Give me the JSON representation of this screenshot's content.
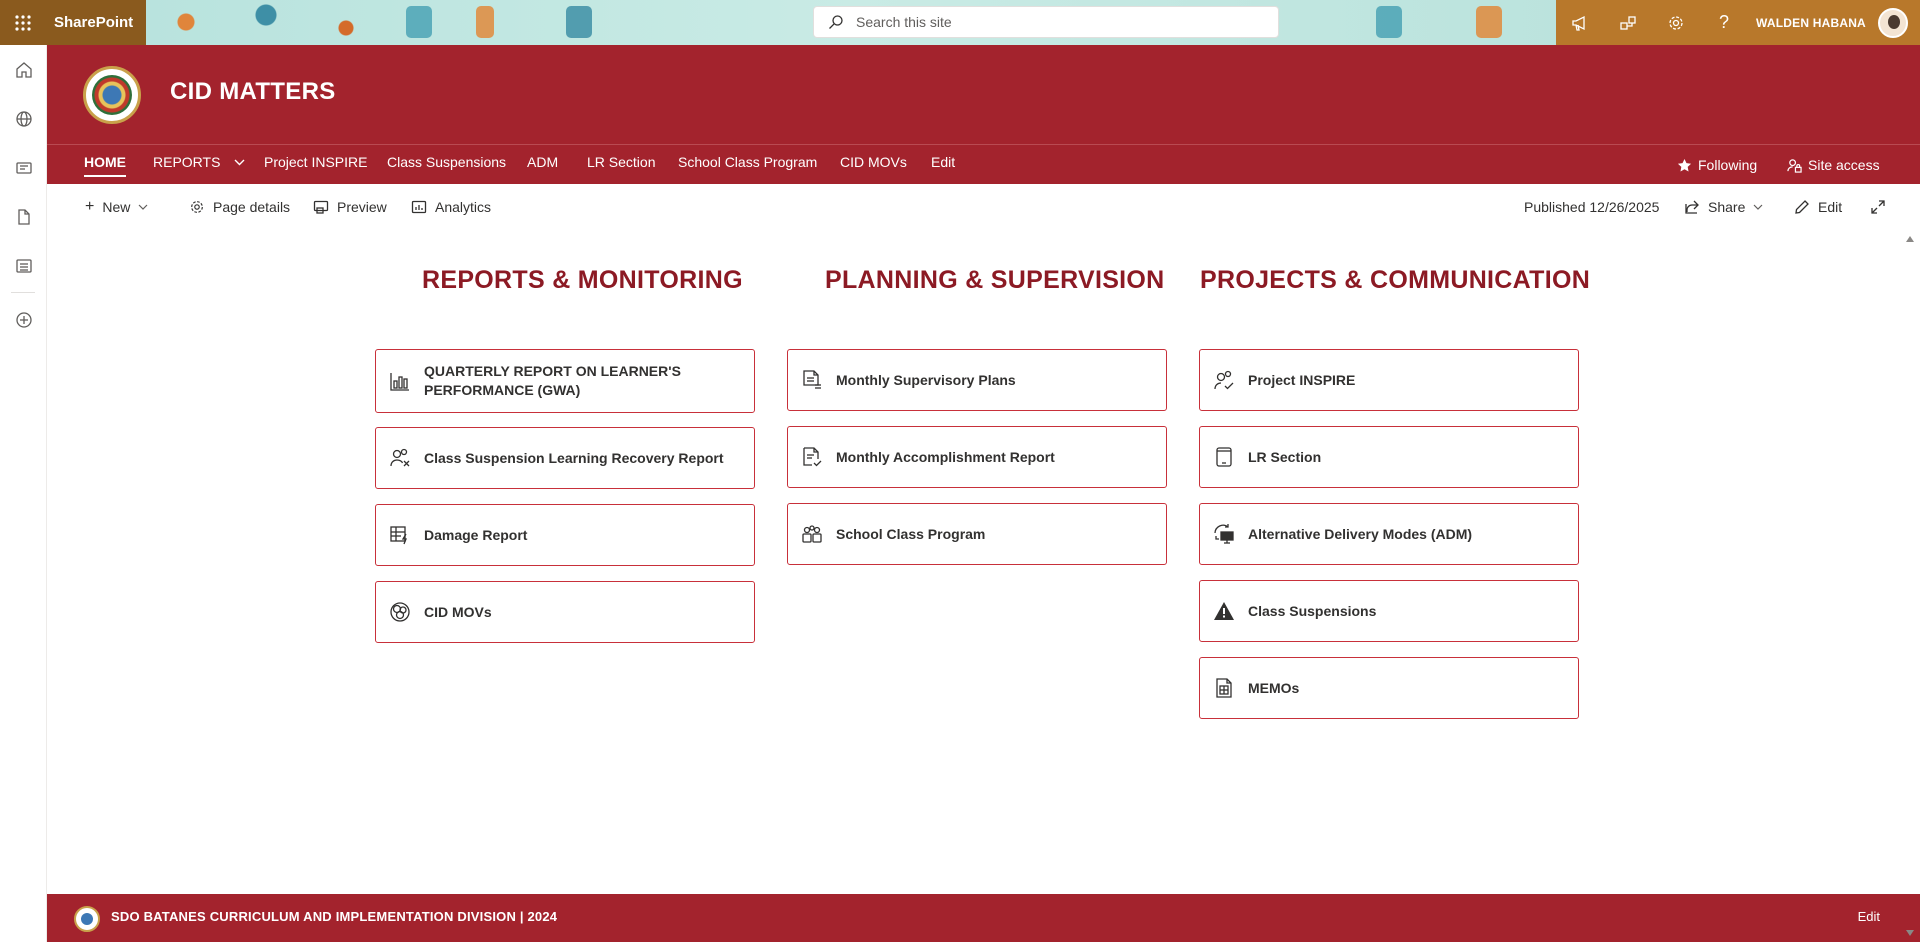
{
  "suite": {
    "brand": "SharePoint",
    "search_placeholder": "Search this site",
    "user_name": "WALDEN HABANA"
  },
  "site": {
    "title": "CID MATTERS"
  },
  "nav": {
    "items": [
      {
        "label": "HOME",
        "active": true
      },
      {
        "label": "REPORTS"
      },
      {
        "label": "Project INSPIRE"
      },
      {
        "label": "Class Suspensions"
      },
      {
        "label": "ADM"
      },
      {
        "label": "LR Section"
      },
      {
        "label": "School Class Program"
      },
      {
        "label": "CID MOVs"
      },
      {
        "label": "Edit"
      }
    ],
    "following": "Following",
    "site_access": "Site access"
  },
  "command": {
    "new": "New",
    "page_details": "Page details",
    "preview": "Preview",
    "analytics": "Analytics",
    "published": "Published 12/26/2025",
    "share": "Share",
    "edit": "Edit"
  },
  "sections": [
    {
      "title": "REPORTS & MONITORING",
      "links": [
        {
          "label": "QUARTERLY REPORT ON LEARNER'S PERFORMANCE (GWA)",
          "icon": "bar-chart-icon"
        },
        {
          "label": "Class Suspension Learning Recovery Report",
          "icon": "people-remove-icon"
        },
        {
          "label": "Damage Report",
          "icon": "table-lightning-icon"
        },
        {
          "label": "CID MOVs",
          "icon": "cluster-icon"
        }
      ]
    },
    {
      "title": "PLANNING & SUPERVISION",
      "links": [
        {
          "label": "Monthly Supervisory Plans",
          "icon": "document-list-icon"
        },
        {
          "label": "Monthly Accomplishment Report",
          "icon": "document-check-icon"
        },
        {
          "label": "School Class Program",
          "icon": "people-group-icon"
        }
      ]
    },
    {
      "title": "PROJECTS & COMMUNICATION",
      "links": [
        {
          "label": "Project INSPIRE",
          "icon": "people-check-icon"
        },
        {
          "label": "LR Section",
          "icon": "tablet-icon"
        },
        {
          "label": "Alternative Delivery Modes (ADM)",
          "icon": "monitor-sync-icon"
        },
        {
          "label": "Class Suspensions",
          "icon": "warning-icon"
        },
        {
          "label": "MEMOs",
          "icon": "document-table-icon"
        }
      ]
    }
  ],
  "footer": {
    "text": "SDO BATANES CURRICULUM AND IMPLEMENTATION DIVISION | 2024",
    "edit": "Edit"
  }
}
